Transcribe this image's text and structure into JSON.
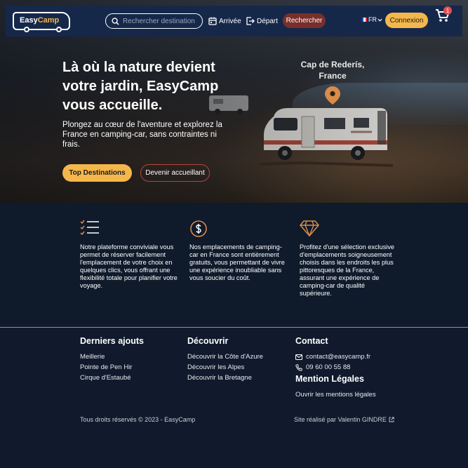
{
  "navbar": {
    "logo_text_a": "Easy",
    "logo_text_b": "Camp",
    "search_placeholder": "Rechercher destination",
    "arrival_label": "Arrivée",
    "departure_label": "Départ",
    "search_button": "Rechercher",
    "language": "FR",
    "login_button": "Connexion",
    "cart_count": "1"
  },
  "hero": {
    "title": "Là où la nature devient votre jardin, EasyCamp vous accueille.",
    "subtitle": "Plongez au cœur de l'aventure et explorez la France en camping-car, sans contraintes ni frais.",
    "primary_button": "Top Destinations",
    "secondary_button": "Devenir accueillant",
    "place_line1": "Cap de Rederís,",
    "place_line2": "France"
  },
  "features": [
    {
      "icon": "checklist-icon",
      "text": "Notre plateforme conviviale vous permet de réserver facilement l'emplacement de votre choix en quelques clics, vous offrant une flexibilité totale pour planifier votre voyage."
    },
    {
      "icon": "dollar-coin-icon",
      "text": "Nos emplacements de camping-car en France sont entièrement gratuits, vous permettant de vivre une expérience inoubliable sans vous soucier du coût."
    },
    {
      "icon": "diamond-icon",
      "text": "Profitez d'une sélection exclusive d'emplacements soigneusement choisis dans les endroits les plus pittoresques de la France, assurant une expérience de camping-car de qualité supérieure."
    }
  ],
  "footer": {
    "latest": {
      "title": "Derniers ajouts",
      "items": [
        "Meillerie",
        "Pointe de Pen Hir",
        "Cirque d'Estaubé"
      ]
    },
    "discover": {
      "title": "Découvrir",
      "items": [
        "Découvrir la Côte d'Azure",
        "Découvrir les Alpes",
        "Découvrir la Bretagne"
      ]
    },
    "contact": {
      "title": "Contact",
      "email": "contact@easycamp.fr",
      "phone": "09 60 00 55 88"
    },
    "legal": {
      "title": "Mention Légales",
      "link": "Ouvrir les mentions légales"
    },
    "copyright": "Tous droits réservés © 2023 - EasyCamp",
    "credit": "Site réalisé par Valentin GINDRE"
  },
  "colors": {
    "accent": "#f4b74b",
    "navbar": "#16284a",
    "background": "#101a2c",
    "search_button": "#7a2e2a"
  }
}
